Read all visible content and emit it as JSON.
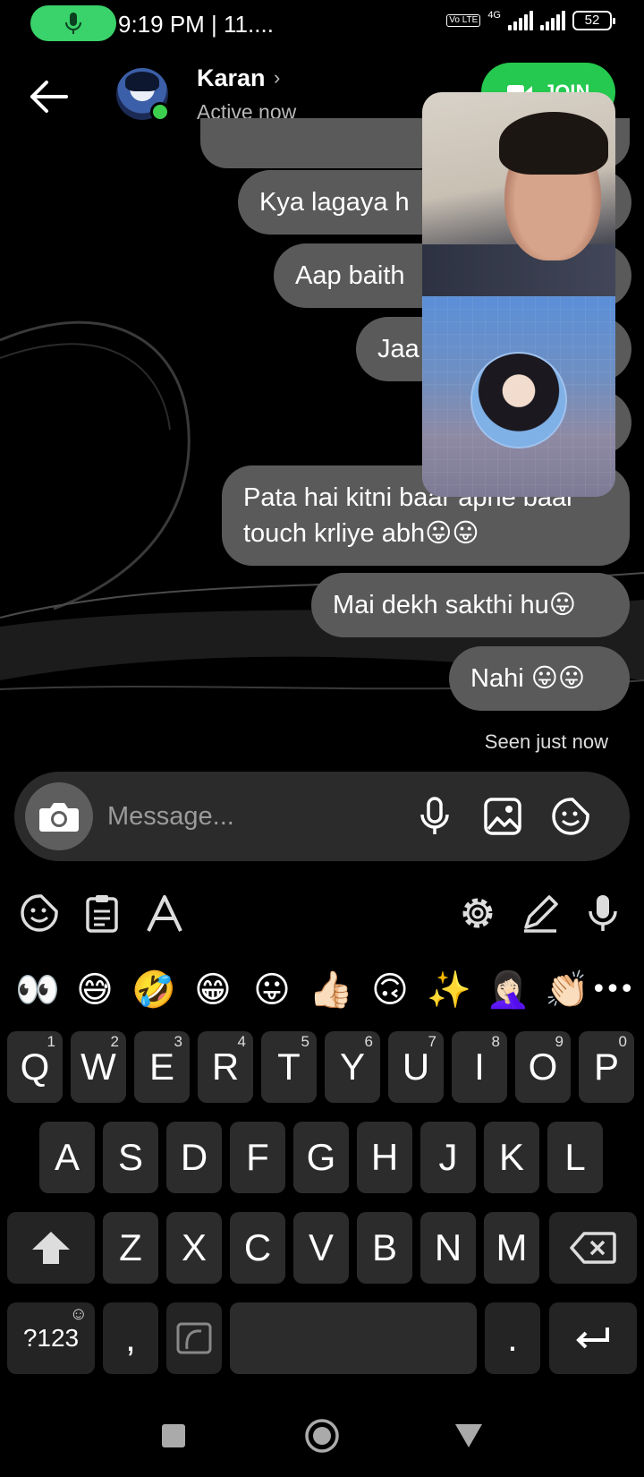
{
  "status_bar": {
    "time": "9:19 PM | 11....",
    "network": "4G",
    "volte": "Vo LTE",
    "battery": "52"
  },
  "header": {
    "contact_name": "Karan",
    "contact_status": "Active now",
    "join_label": "JOIN"
  },
  "messages": [
    {
      "text": "Kya lagaya h"
    },
    {
      "text": "Aap baith"
    },
    {
      "text": "Jaa"
    },
    {
      "text": "Pata hai kitni baar apne baal touch krliye abh😛😛"
    },
    {
      "text": "Mai dekh sakthi hu😛"
    },
    {
      "text": "Nahi 😛😛"
    }
  ],
  "seen_label": "Seen just now",
  "composer": {
    "placeholder": "Message..."
  },
  "keyboard": {
    "emoji_row": [
      "👀",
      "😅",
      "🤣",
      "😁",
      "😛",
      "👍🏻",
      "🙃",
      "✨",
      "🤦🏻‍♀️",
      "👏🏻"
    ],
    "row1": [
      {
        "key": "Q",
        "sup": "1"
      },
      {
        "key": "W",
        "sup": "2"
      },
      {
        "key": "E",
        "sup": "3"
      },
      {
        "key": "R",
        "sup": "4"
      },
      {
        "key": "T",
        "sup": "5"
      },
      {
        "key": "Y",
        "sup": "6"
      },
      {
        "key": "U",
        "sup": "7"
      },
      {
        "key": "I",
        "sup": "8"
      },
      {
        "key": "O",
        "sup": "9"
      },
      {
        "key": "P",
        "sup": "0"
      }
    ],
    "row2": [
      "A",
      "S",
      "D",
      "F",
      "G",
      "H",
      "J",
      "K",
      "L"
    ],
    "row3": [
      "Z",
      "X",
      "C",
      "V",
      "B",
      "N",
      "M"
    ],
    "symbols_label": "?123",
    "comma_label": ",",
    "period_label": "."
  },
  "colors": {
    "accent_green": "#25c94f",
    "bubble": "#5a5a5a",
    "key": "#2c2c2c"
  }
}
